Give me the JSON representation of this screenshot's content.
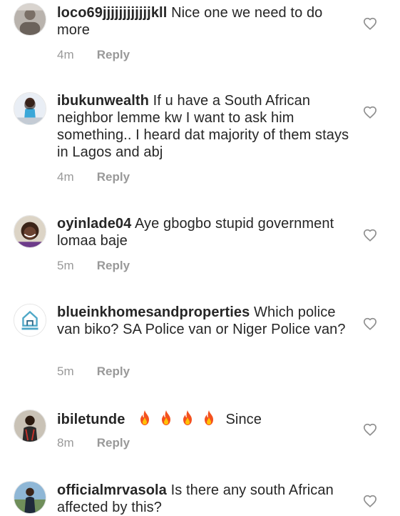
{
  "comments": [
    {
      "username": "loco69jjjjjjjjjjjjkll",
      "text": "Nice one we need to do more",
      "time": "4m",
      "reply": "Reply"
    },
    {
      "username": "ibukunwealth",
      "text": "If u have a South African neighbor lemme kw I want to ask him something.. I heard dat majority of them stays in Lagos and abj",
      "time": "4m",
      "reply": "Reply"
    },
    {
      "username": "oyinlade04",
      "text": "Aye gbogbo stupid government lomaa baje",
      "time": "5m",
      "reply": "Reply"
    },
    {
      "username": "blueinkhomesandproperties",
      "text": "Which police van biko? SA Police van or Niger Police van?",
      "time": "5m",
      "reply": "Reply"
    },
    {
      "username": "ibiletunde",
      "text": "Since",
      "emoji": [
        "fire-icon",
        "fire-icon",
        "fire-icon",
        "fire-icon"
      ],
      "time": "8m",
      "reply": "Reply"
    },
    {
      "username": "officialmrvasola",
      "text": "Is there any south African affected by this?"
    }
  ]
}
